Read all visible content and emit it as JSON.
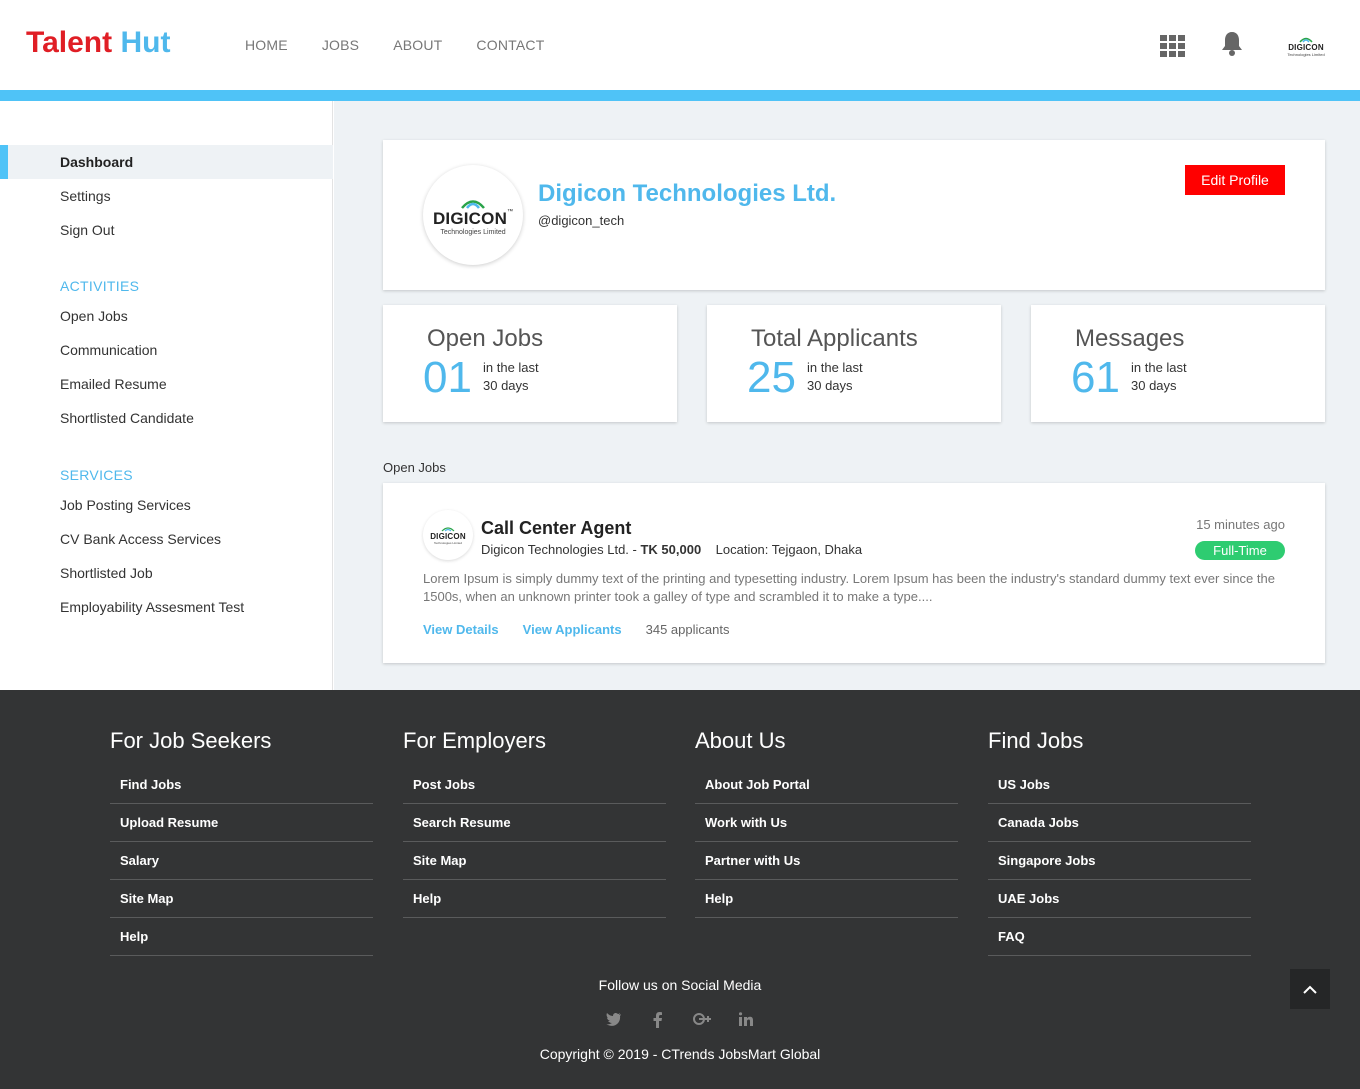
{
  "brand": {
    "word1": "Talent",
    "word2": "Hut"
  },
  "nav": [
    "HOME",
    "JOBS",
    "ABOUT",
    "CONTACT"
  ],
  "header_icons": [
    "grid-icon",
    "bell-icon"
  ],
  "header_avatar": {
    "text": "DIGICON",
    "sub": "Technologies Limited"
  },
  "sidebar": {
    "main_items": [
      "Dashboard",
      "Settings",
      "Sign Out"
    ],
    "activities_heading": "ACTIVITIES",
    "activities": [
      "Open Jobs",
      "Communication",
      "Emailed Resume",
      "Shortlisted Candidate"
    ],
    "services_heading": "SERVICES",
    "services": [
      "Job Posting Services",
      "CV Bank Access Services",
      "Shortlisted Job",
      "Employability Assesment Test"
    ]
  },
  "profile": {
    "logo_text": "DIGICON",
    "logo_tm": "™",
    "logo_sub": "Technologies Limited",
    "name": "Digicon Technologies Ltd.",
    "handle": "@digicon_tech",
    "edit_label": "Edit Profile"
  },
  "stats": [
    {
      "title": "Open Jobs",
      "value": "01",
      "line1": "in the last",
      "line2": "30 days"
    },
    {
      "title": "Total Applicants",
      "value": "25",
      "line1": "in the last",
      "line2": "30 days"
    },
    {
      "title": "Messages",
      "value": "61",
      "line1": "in the last",
      "line2": "30 days"
    }
  ],
  "open_jobs_label": "Open Jobs",
  "job": {
    "logo_text": "DIGICON",
    "logo_sub": "Technologies Limited",
    "title": "Call Center Agent",
    "company": "Digicon Technologies Ltd. -",
    "salary": "TK 50,000",
    "location": "Location: Tejgaon, Dhaka",
    "time": "15 minutes ago",
    "type": "Full-Time",
    "description": "Lorem Ipsum is simply dummy text of the printing and typesetting industry. Lorem Ipsum has been the industry's standard dummy text ever since the 1500s, when an unknown printer took a galley of type and scrambled it to make a type....",
    "view_details": "View Details",
    "view_applicants": "View Applicants",
    "applicants": "345 applicants"
  },
  "footer": {
    "columns": [
      {
        "title": "For Job Seekers",
        "links": [
          "Find Jobs",
          "Upload Resume",
          "Salary",
          "Site Map",
          "Help"
        ]
      },
      {
        "title": "For Employers",
        "links": [
          "Post Jobs",
          "Search Resume",
          "Site Map",
          "Help"
        ]
      },
      {
        "title": "About Us",
        "links": [
          "About Job Portal",
          "Work with Us",
          "Partner with Us",
          "Help"
        ]
      },
      {
        "title": "Find Jobs",
        "links": [
          "US Jobs",
          "Canada Jobs",
          "Singapore Jobs",
          "UAE Jobs",
          "FAQ"
        ]
      }
    ],
    "follow": "Follow us on Social Media",
    "social": [
      "twitter-icon",
      "facebook-icon",
      "google-plus-icon",
      "linkedin-icon"
    ],
    "copyright": "Copyright © 2019 - CTrends JobsMart Global"
  },
  "colors": {
    "brand_red": "#e01e25",
    "accent_blue": "#4fb8ec",
    "edit_red": "#ff0000",
    "badge_green": "#2ecc71",
    "footer_bg": "#333435"
  }
}
